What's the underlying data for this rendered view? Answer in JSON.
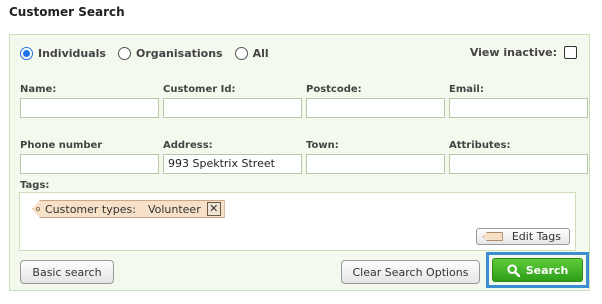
{
  "page": {
    "title": "Customer Search"
  },
  "type_filter": {
    "options": [
      {
        "label": "Individuals",
        "checked": true
      },
      {
        "label": "Organisations",
        "checked": false
      },
      {
        "label": "All",
        "checked": false
      }
    ],
    "view_inactive_label": "View inactive:",
    "view_inactive_checked": false
  },
  "fields": {
    "name": {
      "label": "Name:",
      "value": ""
    },
    "customer_id": {
      "label": "Customer Id:",
      "value": ""
    },
    "postcode": {
      "label": "Postcode:",
      "value": ""
    },
    "email": {
      "label": "Email:",
      "value": ""
    },
    "phone": {
      "label": "Phone number",
      "value": ""
    },
    "address": {
      "label": "Address:",
      "value": "993 Spektrix Street"
    },
    "town": {
      "label": "Town:",
      "value": ""
    },
    "attributes": {
      "label": "Attributes:",
      "value": ""
    }
  },
  "tags": {
    "label": "Tags:",
    "items": [
      {
        "type": "Customer types:",
        "value": "Volunteer",
        "remove": "✕"
      }
    ],
    "edit_label": "Edit Tags"
  },
  "buttons": {
    "basic_search": "Basic search",
    "clear": "Clear Search Options",
    "search": "Search"
  },
  "colors": {
    "accent_blue": "#3b8fd0",
    "search_green": "#3fb22a",
    "panel_bg": "#f4f9ee"
  }
}
